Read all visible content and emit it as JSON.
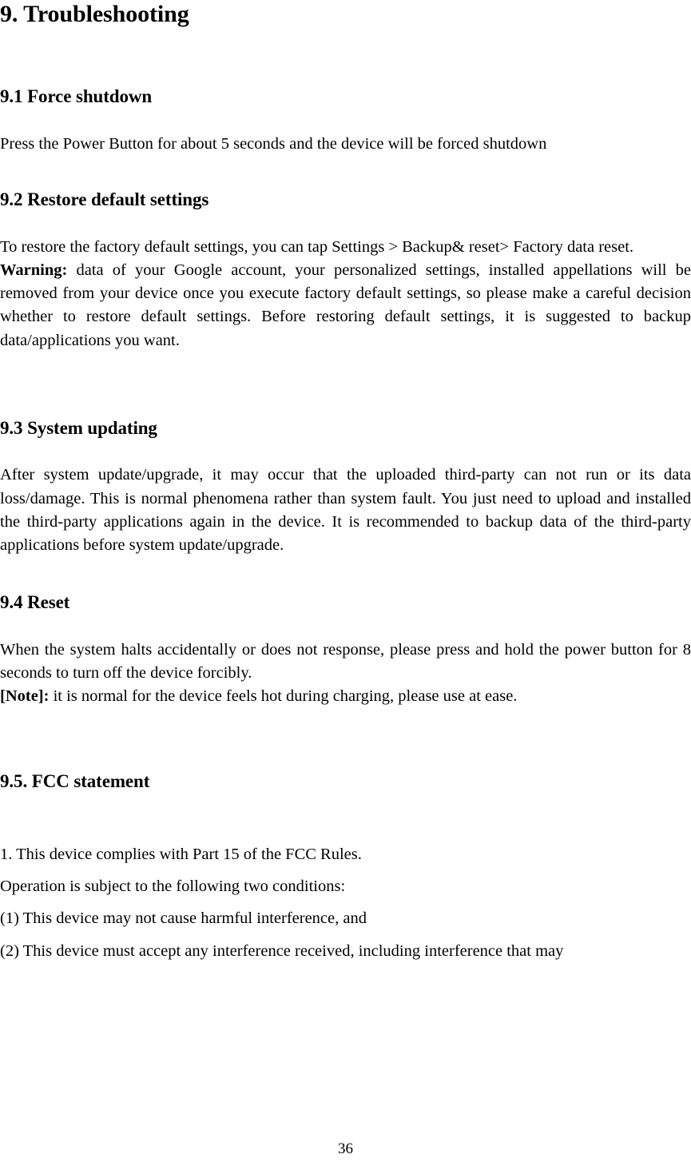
{
  "document": {
    "title": "9. Troubleshooting",
    "page_number": "36"
  },
  "sections": [
    {
      "heading": "9.1 Force shutdown",
      "paragraphs": [
        {
          "text": "Press the Power Button for about 5 seconds and the device will be forced shutdown"
        }
      ]
    },
    {
      "heading": "9.2 Restore default settings",
      "paragraphs": [
        {
          "text": "To restore the factory default settings, you can tap Settings > Backup& reset> Factory data reset."
        },
        {
          "lead_bold": "Warning:",
          "text": " data of your Google account, your personalized settings, installed appellations will be removed from your device once you execute factory default settings, so please make a careful decision whether to restore default settings. Before restoring default settings, it is suggested to backup data/applications you want."
        }
      ]
    },
    {
      "heading": "9.3 System updating",
      "paragraphs": [
        {
          "text": "After system update/upgrade, it may occur that the uploaded third-party can not run or its data loss/damage. This is normal phenomena rather than system fault. You just need to upload and installed the third-party applications again in the device. It is recommended to backup data of the third-party applications before system update/upgrade."
        }
      ]
    },
    {
      "heading": "9.4 Reset",
      "paragraphs": [
        {
          "text": "When the system halts accidentally or does not response, please press and hold the power button for 8 seconds to turn off the device forcibly."
        },
        {
          "lead_bold": "[Note]:",
          "text": " it is normal for the device feels hot during charging, please use at ease."
        }
      ]
    },
    {
      "heading": "9.5. FCC statement",
      "paragraphs": [
        {
          "text": "1. This device complies with Part 15 of the FCC Rules."
        },
        {
          "text": "Operation is subject to the following two conditions:"
        },
        {
          "text": "(1) This device may not cause harmful interference, and"
        },
        {
          "text": "(2) This device must accept any interference received, including interference that may"
        }
      ]
    }
  ]
}
